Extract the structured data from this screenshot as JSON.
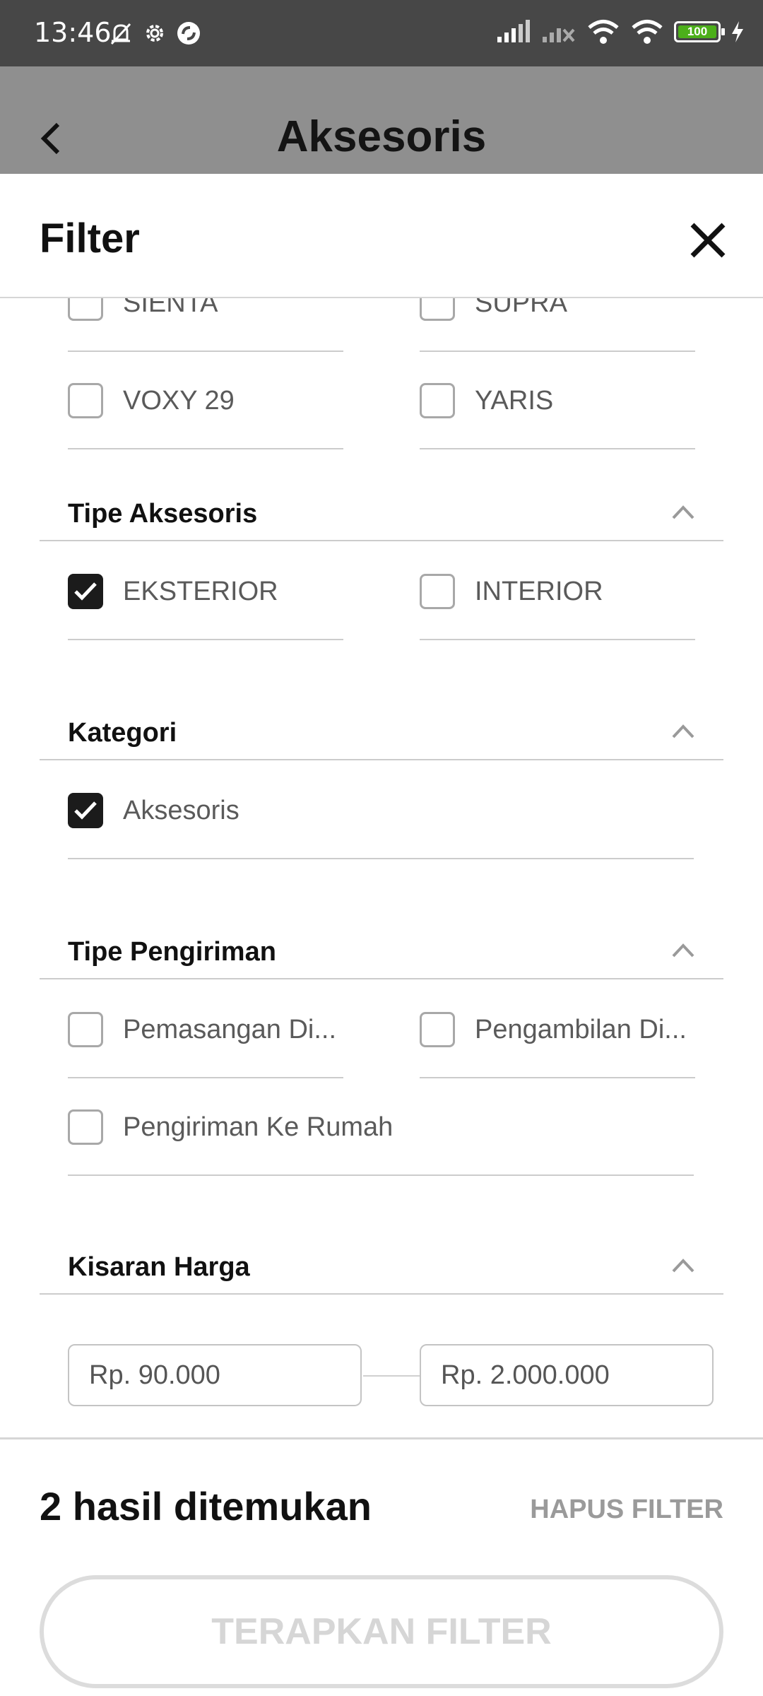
{
  "status_bar": {
    "time": "13:46",
    "battery": "100"
  },
  "header": {
    "title": "Aksesoris"
  },
  "filter": {
    "title": "Filter",
    "model_items": [
      {
        "label": "SIENTA",
        "checked": false
      },
      {
        "label": "SUPRA",
        "checked": false
      },
      {
        "label": "VOXY 29",
        "checked": false
      },
      {
        "label": "YARIS",
        "checked": false
      }
    ],
    "sections": {
      "tipe_aksesoris": {
        "title": "Tipe Aksesoris",
        "items": [
          {
            "label": "EKSTERIOR",
            "checked": true
          },
          {
            "label": "INTERIOR",
            "checked": false
          }
        ]
      },
      "kategori": {
        "title": "Kategori",
        "items": [
          {
            "label": "Aksesoris",
            "checked": true
          }
        ]
      },
      "tipe_pengiriman": {
        "title": "Tipe Pengiriman",
        "items": [
          {
            "label": "Pemasangan Di...",
            "checked": false
          },
          {
            "label": "Pengambilan Di...",
            "checked": false
          },
          {
            "label": "Pengiriman Ke Rumah",
            "checked": false
          }
        ]
      },
      "kisaran_harga": {
        "title": "Kisaran Harga",
        "min": "Rp. 90.000",
        "max": "Rp. 2.000.000"
      }
    }
  },
  "footer": {
    "result_text": "2 hasil ditemukan",
    "reset_label": "HAPUS FILTER",
    "apply_label": "TERAPKAN FILTER"
  }
}
